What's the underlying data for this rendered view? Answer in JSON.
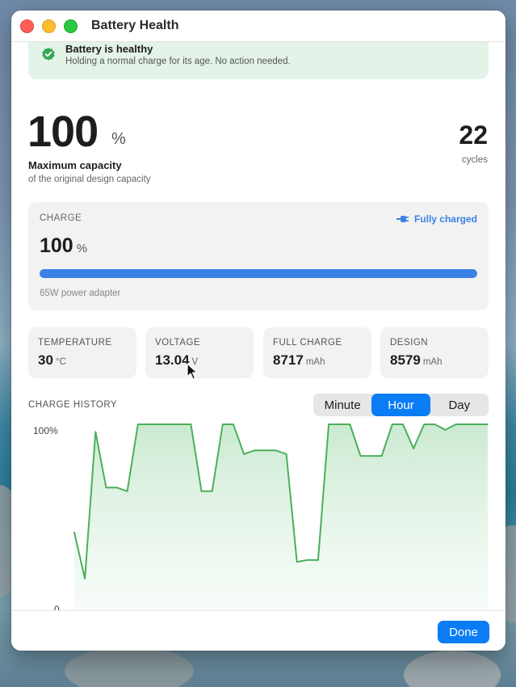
{
  "window": {
    "title": "Battery Health"
  },
  "health_banner": {
    "title": "Battery is healthy",
    "description": "Holding a normal charge for its age. No action needed.",
    "icon": "checkmark-badge-icon",
    "color": "#34a853"
  },
  "capacity": {
    "value": "100",
    "unit": "%",
    "label": "Maximum capacity",
    "sublabel": "of the original design capacity"
  },
  "cycles": {
    "value": "22",
    "label": "cycles"
  },
  "charge": {
    "caption": "CHARGE",
    "status": "Fully charged",
    "status_icon": "plug-icon",
    "value": "100",
    "unit": "%",
    "level_percent": 100,
    "adapter": "65W power adapter",
    "accent": "#3b82e6"
  },
  "stats": [
    {
      "label": "TEMPERATURE",
      "value": "30",
      "unit": "°C"
    },
    {
      "label": "VOLTAGE",
      "value": "13.04",
      "unit": "V"
    },
    {
      "label": "FULL CHARGE",
      "value": "8717",
      "unit": "mAh"
    },
    {
      "label": "DESIGN",
      "value": "8579",
      "unit": "mAh"
    }
  ],
  "history": {
    "title": "CHARGE HISTORY",
    "tabs": [
      "Minute",
      "Hour",
      "Day"
    ],
    "selected_tab": "Hour"
  },
  "footer": {
    "done_label": "Done"
  },
  "chart_data": {
    "type": "area",
    "title": "",
    "xlabel": "",
    "ylabel": "",
    "y_tick_labels": [
      "100%",
      "0"
    ],
    "ylim": [
      0,
      100
    ],
    "grid": false,
    "line_color": "#4caf5a",
    "y": [
      42,
      17,
      96,
      66,
      66,
      64,
      100,
      100,
      100,
      100,
      100,
      100,
      64,
      64,
      100,
      100,
      84,
      86,
      86,
      86,
      84,
      26,
      27,
      27,
      100,
      100,
      100,
      83,
      83,
      83,
      100,
      100,
      87,
      100,
      100,
      97,
      100,
      100,
      100,
      100
    ]
  }
}
